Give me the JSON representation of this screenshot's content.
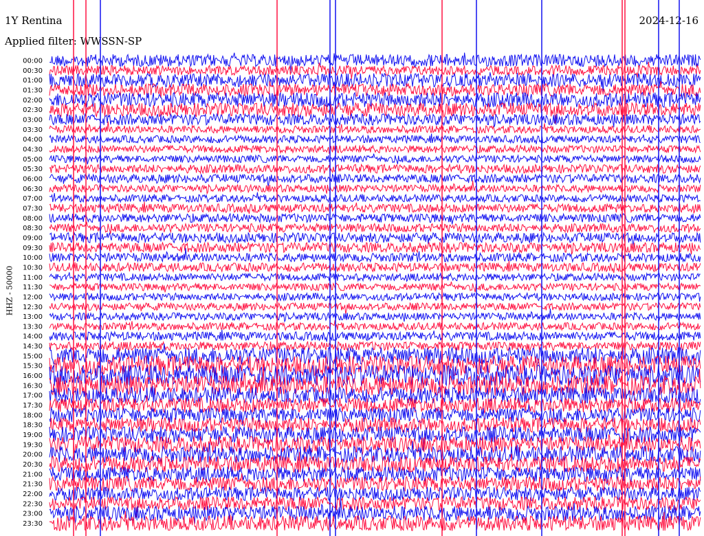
{
  "header": {
    "station": "1Y Rentina",
    "filter": "Applied filter: WWSSN-SP",
    "date": "2024-12-16"
  },
  "chart_data": {
    "type": "line",
    "title": "1Y Rentina",
    "subtitle": "Applied filter: WWSSN-SP",
    "ylabel": "HHZ - 50000",
    "xlabel": "",
    "date": "2024-12-16",
    "row_labels": [
      "00:00",
      "00:30",
      "01:00",
      "01:30",
      "02:00",
      "02:30",
      "03:00",
      "03:30",
      "04:00",
      "04:30",
      "05:00",
      "05:30",
      "06:00",
      "06:30",
      "07:00",
      "07:30",
      "08:00",
      "08:30",
      "09:00",
      "09:30",
      "10:00",
      "10:30",
      "11:00",
      "11:30",
      "12:00",
      "12:30",
      "13:00",
      "13:30",
      "14:00",
      "14:30",
      "15:00",
      "15:30",
      "16:00",
      "16:30",
      "17:00",
      "17:30",
      "18:00",
      "18:30",
      "19:00",
      "19:30",
      "20:00",
      "20:30",
      "21:00",
      "21:30",
      "22:00",
      "22:30",
      "23:00",
      "23:30"
    ],
    "trace_colors": [
      "#1010f0",
      "#ff1040"
    ],
    "row_amplitude": [
      1.0,
      0.8,
      1.1,
      1.0,
      1.2,
      1.1,
      0.9,
      0.6,
      0.6,
      0.6,
      0.6,
      0.7,
      0.7,
      0.6,
      0.6,
      0.7,
      0.7,
      0.7,
      0.8,
      0.8,
      0.7,
      0.7,
      0.6,
      0.6,
      0.6,
      0.6,
      0.6,
      0.6,
      0.7,
      0.7,
      1.4,
      1.6,
      1.7,
      1.6,
      1.3,
      1.2,
      1.2,
      1.2,
      1.3,
      1.3,
      1.3,
      1.3,
      1.2,
      1.2,
      1.1,
      1.1,
      1.2,
      1.2
    ],
    "grid": false,
    "legend": "none"
  }
}
